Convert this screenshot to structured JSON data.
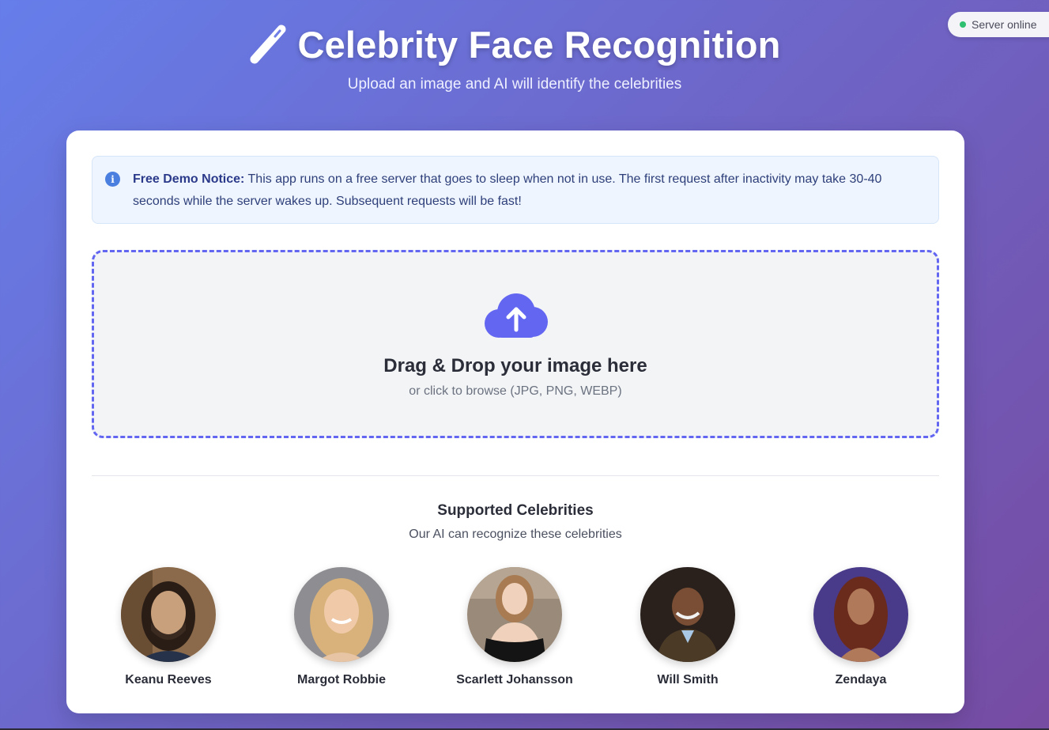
{
  "status": {
    "label": "Server online",
    "color": "#2fbf71"
  },
  "header": {
    "title": "Celebrity Face Recognition",
    "subtitle": "Upload an image and AI will identify the celebrities",
    "icon": "magic-wand-icon"
  },
  "notice": {
    "icon": "info-icon",
    "strong": "Free Demo Notice:",
    "text": " This app runs on a free server that goes to sleep when not in use. The first request after inactivity may take 30-40 seconds while the server wakes up. Subsequent requests will be fast!"
  },
  "upload": {
    "icon": "cloud-upload-icon",
    "title": "Drag & Drop your image here",
    "subtitle": "or click to browse (JPG, PNG, WEBP)"
  },
  "celebrities": {
    "title": "Supported Celebrities",
    "subtitle": "Our AI can recognize these celebrities",
    "items": [
      {
        "name": "Keanu Reeves"
      },
      {
        "name": "Margot Robbie"
      },
      {
        "name": "Scarlett Johansson"
      },
      {
        "name": "Will Smith"
      },
      {
        "name": "Zendaya"
      }
    ]
  },
  "colors": {
    "accent": "#6366f1",
    "gradient_start": "#667eea",
    "gradient_end": "#764ba2"
  }
}
